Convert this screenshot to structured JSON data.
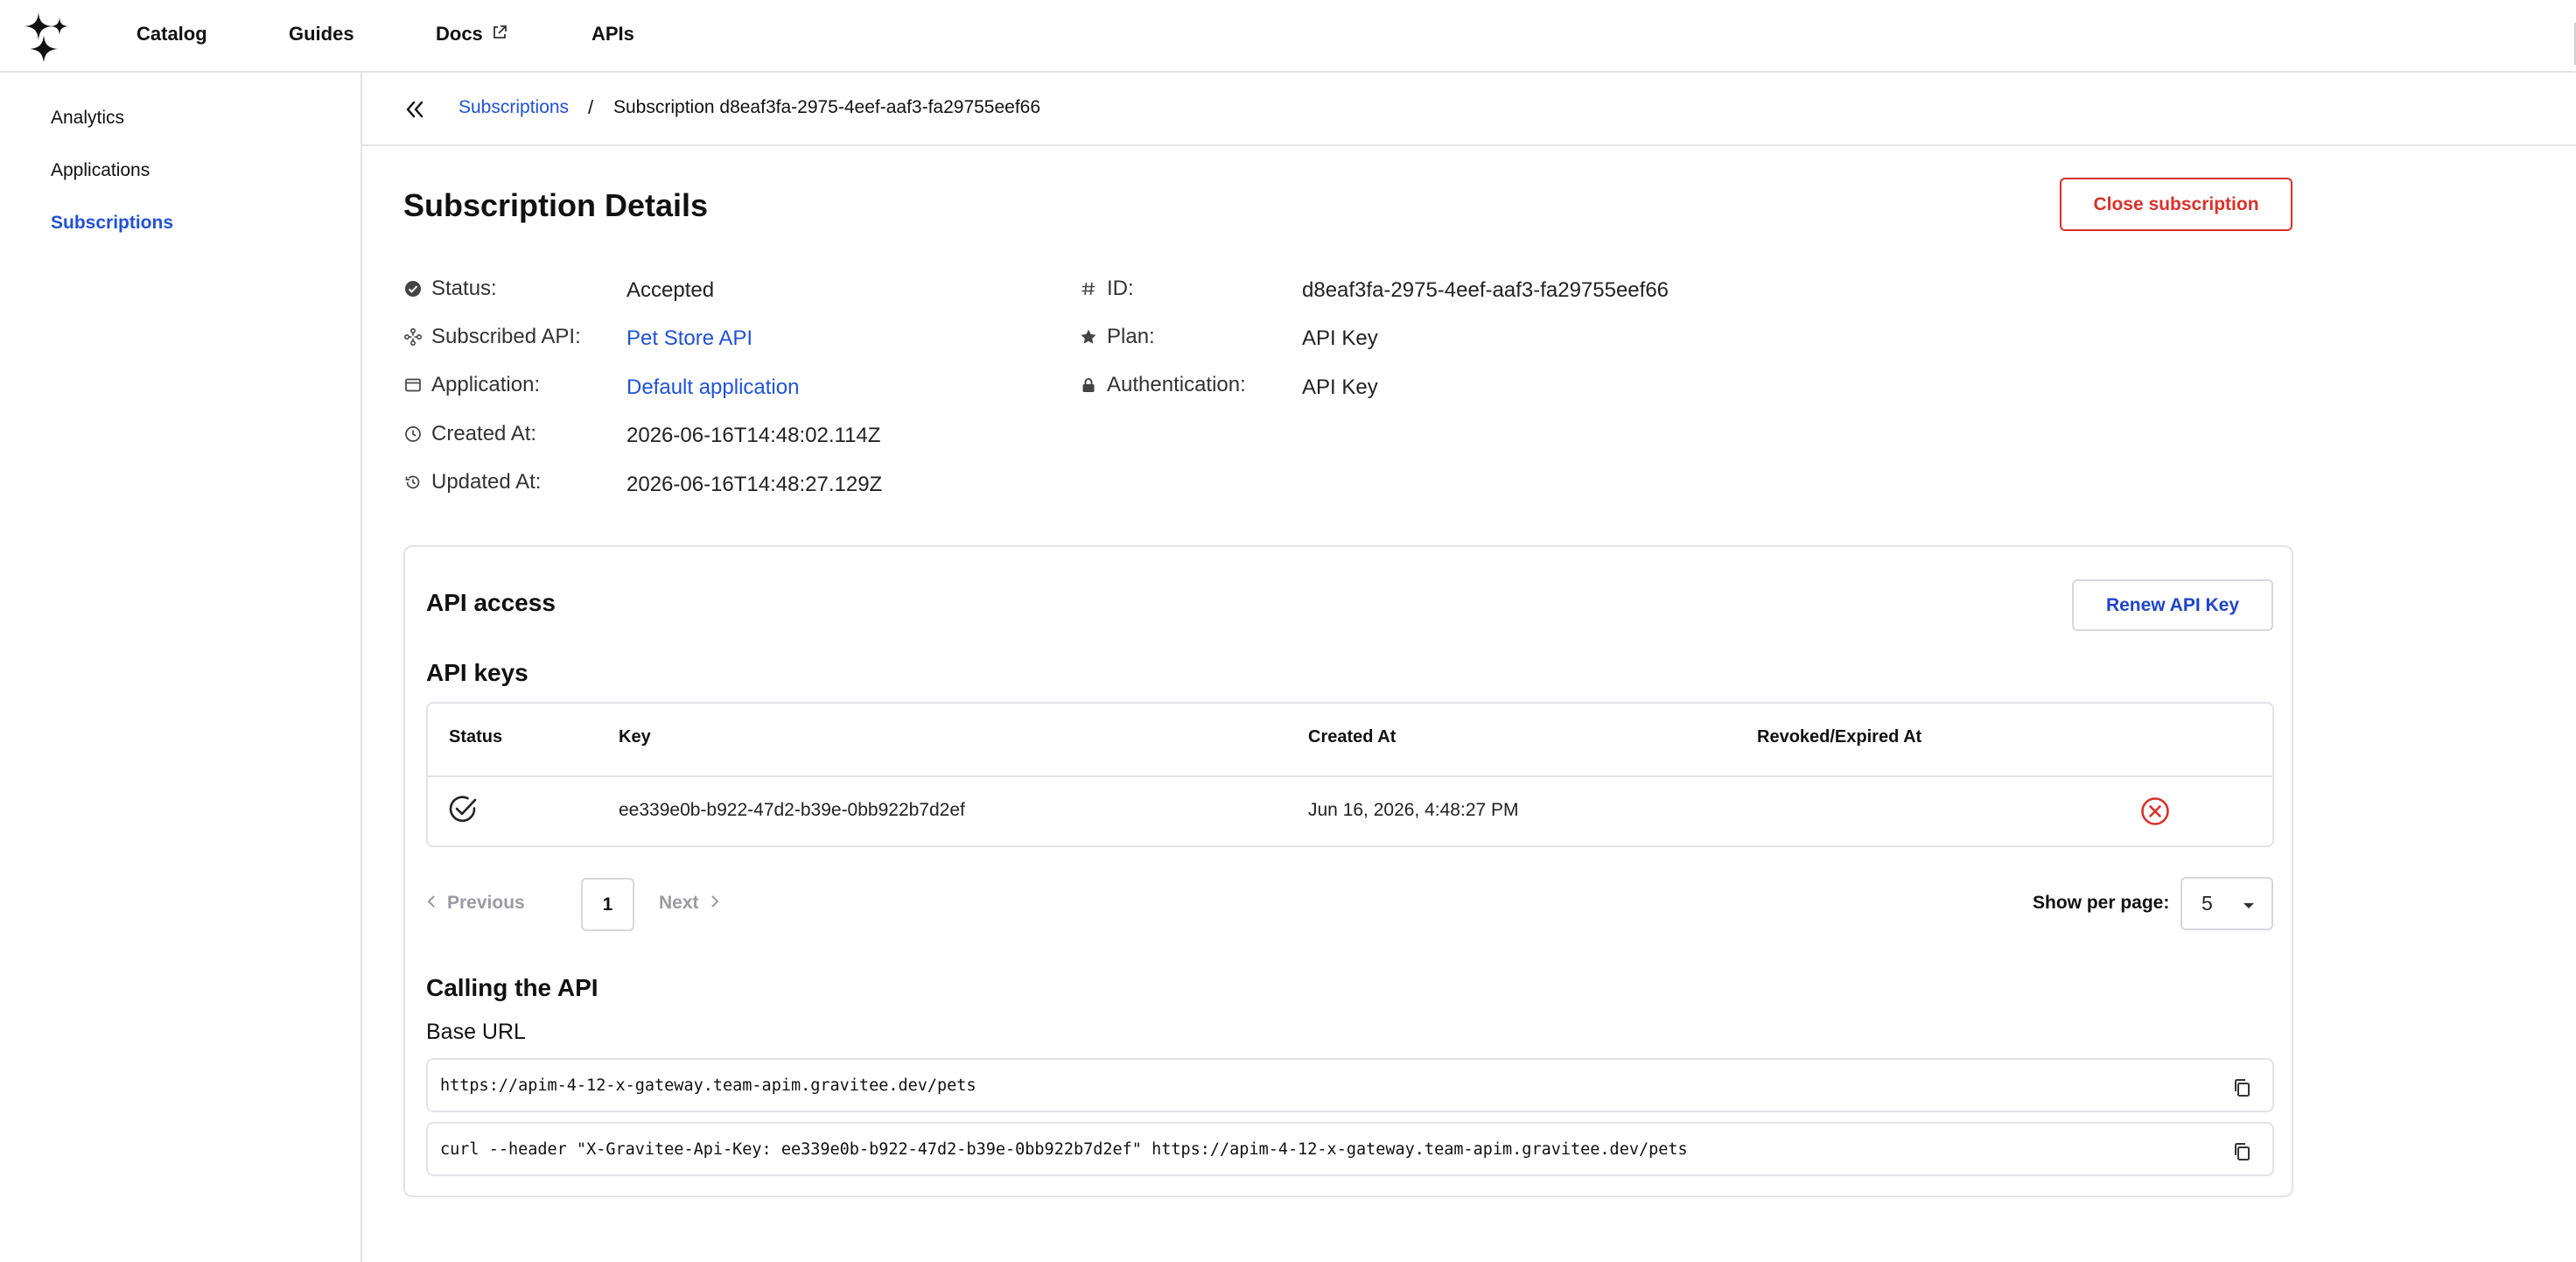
{
  "topnav": {
    "items": [
      {
        "label": "Catalog"
      },
      {
        "label": "Guides"
      },
      {
        "label": "Docs",
        "icon": "external-link-icon"
      },
      {
        "label": "APIs"
      }
    ]
  },
  "sidebar": {
    "items": [
      {
        "label": "Analytics",
        "active": false
      },
      {
        "label": "Applications",
        "active": false
      },
      {
        "label": "Subscriptions",
        "active": true
      }
    ]
  },
  "breadcrumb": {
    "parent": "Subscriptions",
    "separator": "/",
    "current": "Subscription d8eaf3fa-2975-4eef-aaf3-fa29755eef66"
  },
  "page": {
    "title": "Subscription Details",
    "close_button": "Close subscription"
  },
  "details": {
    "left": [
      {
        "icon": "check-circle-icon",
        "label": "Status:",
        "value": "Accepted",
        "link": false
      },
      {
        "icon": "api-icon",
        "label": "Subscribed API:",
        "value": "Pet Store API",
        "link": true
      },
      {
        "icon": "window-icon",
        "label": "Application:",
        "value": "Default application",
        "link": true
      },
      {
        "icon": "clock-icon",
        "label": "Created At:",
        "value": "2026-06-16T14:48:02.114Z",
        "link": false
      },
      {
        "icon": "history-icon",
        "label": "Updated At:",
        "value": "2026-06-16T14:48:27.129Z",
        "link": false
      }
    ],
    "right": [
      {
        "icon": "hash-icon",
        "label": "ID:",
        "value": "d8eaf3fa-2975-4eef-aaf3-fa29755eef66"
      },
      {
        "icon": "star-icon",
        "label": "Plan:",
        "value": "API Key"
      },
      {
        "icon": "lock-icon",
        "label": "Authentication:",
        "value": "API Key"
      }
    ]
  },
  "api_access": {
    "title": "API access",
    "renew_button": "Renew API Key",
    "keys_title": "API keys",
    "table": {
      "headers": [
        "Status",
        "Key",
        "Created At",
        "Revoked/Expired At"
      ],
      "rows": [
        {
          "status_icon": "check-circle-icon",
          "key": "ee339e0b-b922-47d2-b39e-0bb922b7d2ef",
          "created_at": "Jun 16, 2026, 4:48:27 PM",
          "revoked_at": "",
          "action_icon": "revoke-icon"
        }
      ]
    },
    "pagination": {
      "previous": "Previous",
      "page": "1",
      "next": "Next",
      "per_page_label": "Show per page:",
      "per_page_value": "5"
    },
    "calling_title": "Calling the API",
    "base_url_label": "Base URL",
    "base_url": "https://apim-4-12-x-gateway.team-apim.gravitee.dev/pets",
    "curl": "curl --header \"X-Gravitee-Api-Key: ee339e0b-b922-47d2-b39e-0bb922b7d2ef\" https://apim-4-12-x-gateway.team-apim.gravitee.dev/pets"
  },
  "colors": {
    "accent": "#2051d6",
    "danger": "#d9312a",
    "border": "#e3e3e8"
  }
}
